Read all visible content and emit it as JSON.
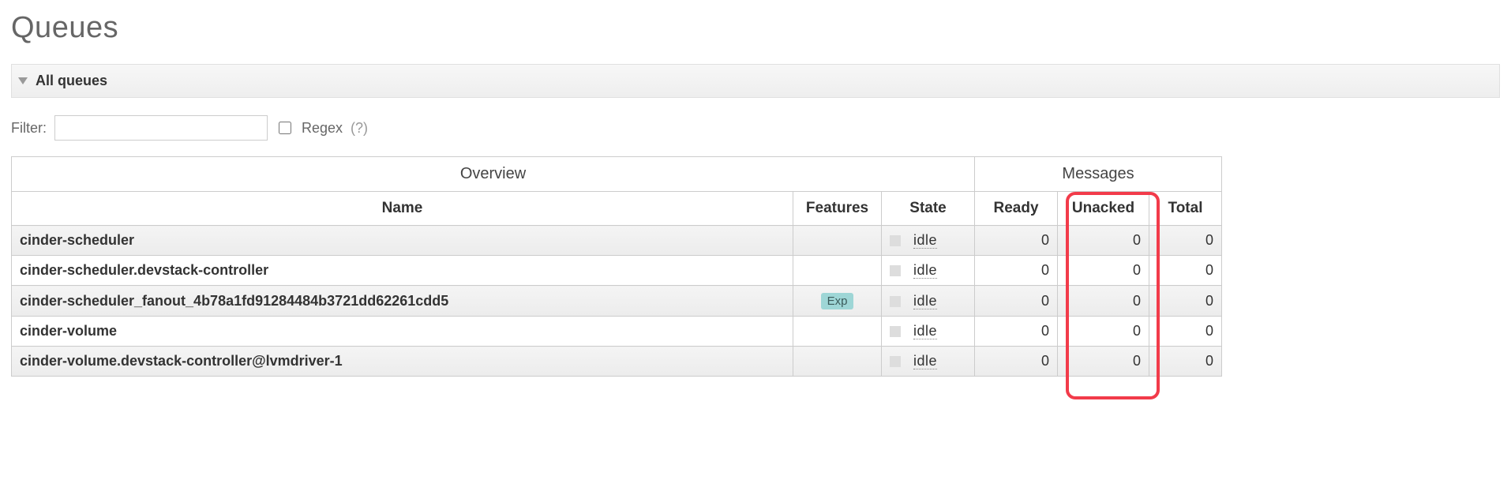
{
  "page": {
    "title": "Queues"
  },
  "section": {
    "title": "All queues"
  },
  "filter": {
    "label": "Filter:",
    "value": "",
    "regex_label": "Regex",
    "help": "(?)"
  },
  "table": {
    "groups": {
      "overview": "Overview",
      "messages": "Messages"
    },
    "headers": {
      "name": "Name",
      "features": "Features",
      "state": "State",
      "ready": "Ready",
      "unacked": "Unacked",
      "total": "Total"
    },
    "rows": [
      {
        "name": "cinder-scheduler",
        "features": "",
        "state": "idle",
        "ready": "0",
        "unacked": "0",
        "total": "0"
      },
      {
        "name": "cinder-scheduler.devstack-controller",
        "features": "",
        "state": "idle",
        "ready": "0",
        "unacked": "0",
        "total": "0"
      },
      {
        "name": "cinder-scheduler_fanout_4b78a1fd91284484b3721dd62261cdd5",
        "features": "Exp",
        "state": "idle",
        "ready": "0",
        "unacked": "0",
        "total": "0"
      },
      {
        "name": "cinder-volume",
        "features": "",
        "state": "idle",
        "ready": "0",
        "unacked": "0",
        "total": "0"
      },
      {
        "name": "cinder-volume.devstack-controller@lvmdriver-1",
        "features": "",
        "state": "idle",
        "ready": "0",
        "unacked": "0",
        "total": "0"
      }
    ]
  }
}
